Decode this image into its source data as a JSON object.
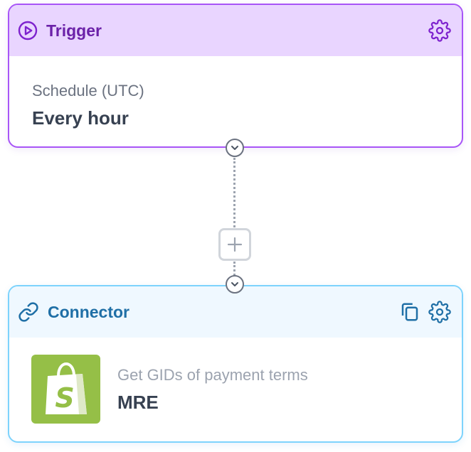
{
  "trigger": {
    "title": "Trigger",
    "label": "Schedule (UTC)",
    "value": "Every hour",
    "icons": [
      "play-circle-icon",
      "gear-icon"
    ],
    "colors": {
      "border": "#a855f7",
      "header_bg": "#e9d5ff",
      "title": "#6b21a8"
    }
  },
  "flow": {
    "icons": [
      "chevron-down-icon",
      "plus-icon"
    ]
  },
  "connector": {
    "title": "Connector",
    "label": "Get GIDs of payment terms",
    "value": "MRE",
    "logo_letter": "S",
    "icons": [
      "link-icon",
      "copy-icon",
      "gear-icon",
      "shopify-logo-icon"
    ],
    "colors": {
      "border": "#7dd3fc",
      "header_bg": "#eff8ff",
      "title": "#1f6fa6",
      "logo_bg": "#95bf47"
    }
  }
}
